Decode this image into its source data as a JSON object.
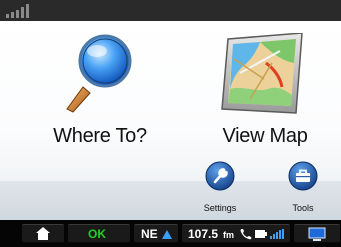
{
  "status_bar": {
    "signal_icon": "gps-signal-bars-icon"
  },
  "main_menu": {
    "where_to": {
      "label": "Where To?",
      "icon": "magnifying-glass-icon"
    },
    "view_map": {
      "label": "View Map",
      "icon": "map-icon"
    },
    "settings": {
      "label": "Settings",
      "icon": "wrench-icon"
    },
    "tools": {
      "label": "Tools",
      "icon": "toolbox-icon"
    }
  },
  "bottom_bar": {
    "home_icon": "home-icon",
    "status_text": "OK",
    "heading": "NE",
    "frequency": "107.5",
    "frequency_unit": "fm",
    "phone_icon": "phone-icon",
    "battery_icon": "battery-icon",
    "bluetooth_signal_icon": "signal-bars-icon",
    "monitor_icon": "monitor-icon",
    "colors": {
      "ok_green": "#1fd11f",
      "heading_arrow": "#3aa0ff"
    }
  }
}
